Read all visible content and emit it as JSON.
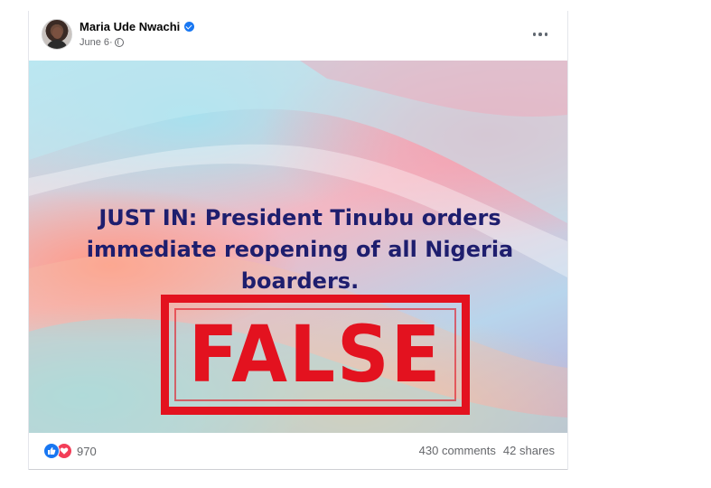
{
  "post": {
    "author": "Maria Ude Nwachi",
    "date": "June 6",
    "date_separator": "·",
    "privacy_icon": "globe-icon",
    "verified_icon": "verified-badge-icon",
    "more_icon": "more-options-icon"
  },
  "image": {
    "headline": "JUST IN: President Tinubu orders immediate reopening of all Nigeria boarders.",
    "stamp": "FALSE",
    "headline_color": "#1e1e6e",
    "stamp_color": "#e3121f"
  },
  "engagement": {
    "reaction_icons": [
      "like-icon",
      "love-icon"
    ],
    "reaction_count": "970",
    "comments": "430 comments",
    "shares": "42 shares"
  },
  "colors": {
    "accent": "#1877f2",
    "love": "#f33e58",
    "secondary_text": "#65676b"
  }
}
